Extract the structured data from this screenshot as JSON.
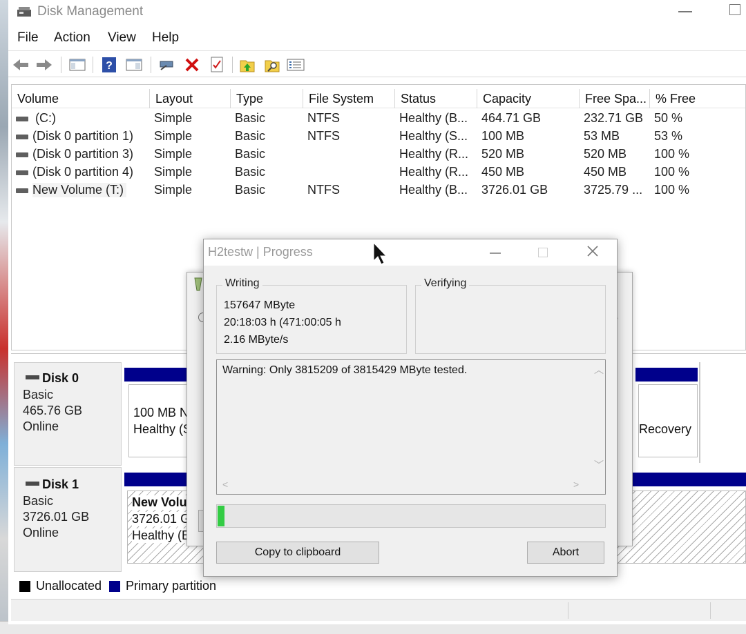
{
  "window": {
    "title": "Disk Management"
  },
  "menu": [
    "File",
    "Action",
    "View",
    "Help"
  ],
  "toolbar": {
    "icons": [
      "back-icon",
      "forward-icon",
      "console-tree-icon",
      "help-icon",
      "show-pane-icon",
      "connect-icon",
      "delete-icon",
      "properties-icon",
      "refresh-icon",
      "rescan-icon",
      "list-icon"
    ]
  },
  "volume_list": {
    "columns": [
      "Volume",
      "Layout",
      "Type",
      "File System",
      "Status",
      "Capacity",
      "Free Spa...",
      "% Free"
    ],
    "rows": [
      [
        "(C:)",
        "Simple",
        "Basic",
        "NTFS",
        "Healthy (B...",
        "464.71 GB",
        "232.71 GB",
        "50 %"
      ],
      [
        "(Disk 0 partition 1)",
        "Simple",
        "Basic",
        "NTFS",
        "Healthy (S...",
        "100 MB",
        "53 MB",
        "53 %"
      ],
      [
        "(Disk 0 partition 3)",
        "Simple",
        "Basic",
        "",
        "Healthy (R...",
        "520 MB",
        "520 MB",
        "100 %"
      ],
      [
        "(Disk 0 partition 4)",
        "Simple",
        "Basic",
        "",
        "Healthy (R...",
        "450 MB",
        "450 MB",
        "100 %"
      ],
      [
        "New Volume (T:)",
        "Simple",
        "Basic",
        "NTFS",
        "Healthy (B...",
        "3726.01 GB",
        "3725.79 ...",
        "100 %"
      ]
    ]
  },
  "disks": [
    {
      "name": "Disk 0",
      "type": "Basic",
      "size": "465.76 GB",
      "state": "Online",
      "partition_left": {
        "line1": "100 MB N",
        "line2": "Healthy (S"
      },
      "partition_right": {
        "line1": "Recovery"
      }
    },
    {
      "name": "Disk 1",
      "type": "Basic",
      "size": "3726.01 GB",
      "state": "Online",
      "partition_left": {
        "line1": "New Volu",
        "line2": "3726.01 G",
        "line3": "Healthy (E"
      }
    }
  ],
  "legend": {
    "unallocated": "Unallocated",
    "primary": "Primary partition",
    "unallocated_color": "#000000",
    "primary_color": "#00008b"
  },
  "dialog": {
    "title": "H2testw | Progress",
    "writing_label": "Writing",
    "writing_lines": [
      "157647 MByte",
      "20:18:03 h (471:00:05 h",
      "2.16 MByte/s"
    ],
    "verifying_label": "Verifying",
    "log_message": "Warning: Only 3815209 of 3815429 MByte tested.",
    "progress_fraction": 0.017,
    "progress_color": "#33cc44",
    "copy_button": "Copy to clipboard",
    "abort_button": "Abort"
  },
  "back_dialog": {
    "fragment": "e"
  }
}
